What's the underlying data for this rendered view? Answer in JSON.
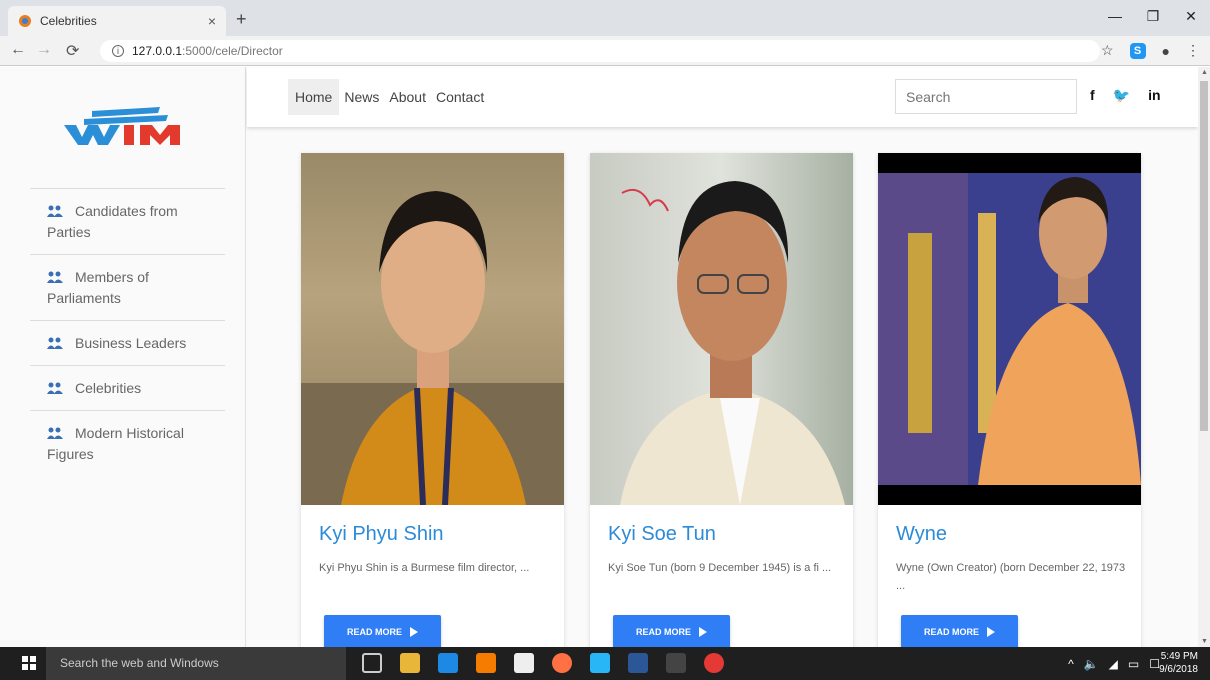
{
  "browser": {
    "tab_title": "Celebrities",
    "tab_close": "×",
    "new_tab": "+",
    "url_host": "127.0.0.1",
    "url_path": ":5000/cele/Director",
    "window_minimize": "—",
    "window_restore": "❐",
    "window_close": "✕"
  },
  "sidebar": {
    "items": [
      {
        "label": "Candidates from Parties"
      },
      {
        "label": "Members of Parliaments"
      },
      {
        "label": "Business Leaders"
      },
      {
        "label": "Celebrities"
      },
      {
        "label": "Modern Historical Figures"
      }
    ]
  },
  "topnav": {
    "links": [
      "Home",
      "News",
      "About",
      "Contact"
    ],
    "search_placeholder": "Search",
    "social": [
      "f",
      "🐦",
      "in"
    ]
  },
  "cards": [
    {
      "name": "Kyi Phyu Shin",
      "desc": "Kyi Phyu Shin is a Burmese film director, ...",
      "button": "READ MORE"
    },
    {
      "name": "Kyi Soe Tun",
      "desc": "Kyi Soe Tun (born 9 December 1945) is a fi ...",
      "button": "READ MORE"
    },
    {
      "name": "Wyne",
      "desc": "Wyne (Own Creator) (born December 22, 1973 ...",
      "button": "READ MORE"
    }
  ],
  "taskbar": {
    "search_placeholder": "Search the web and Windows",
    "time": "5:49 PM",
    "date": "9/6/2018"
  }
}
